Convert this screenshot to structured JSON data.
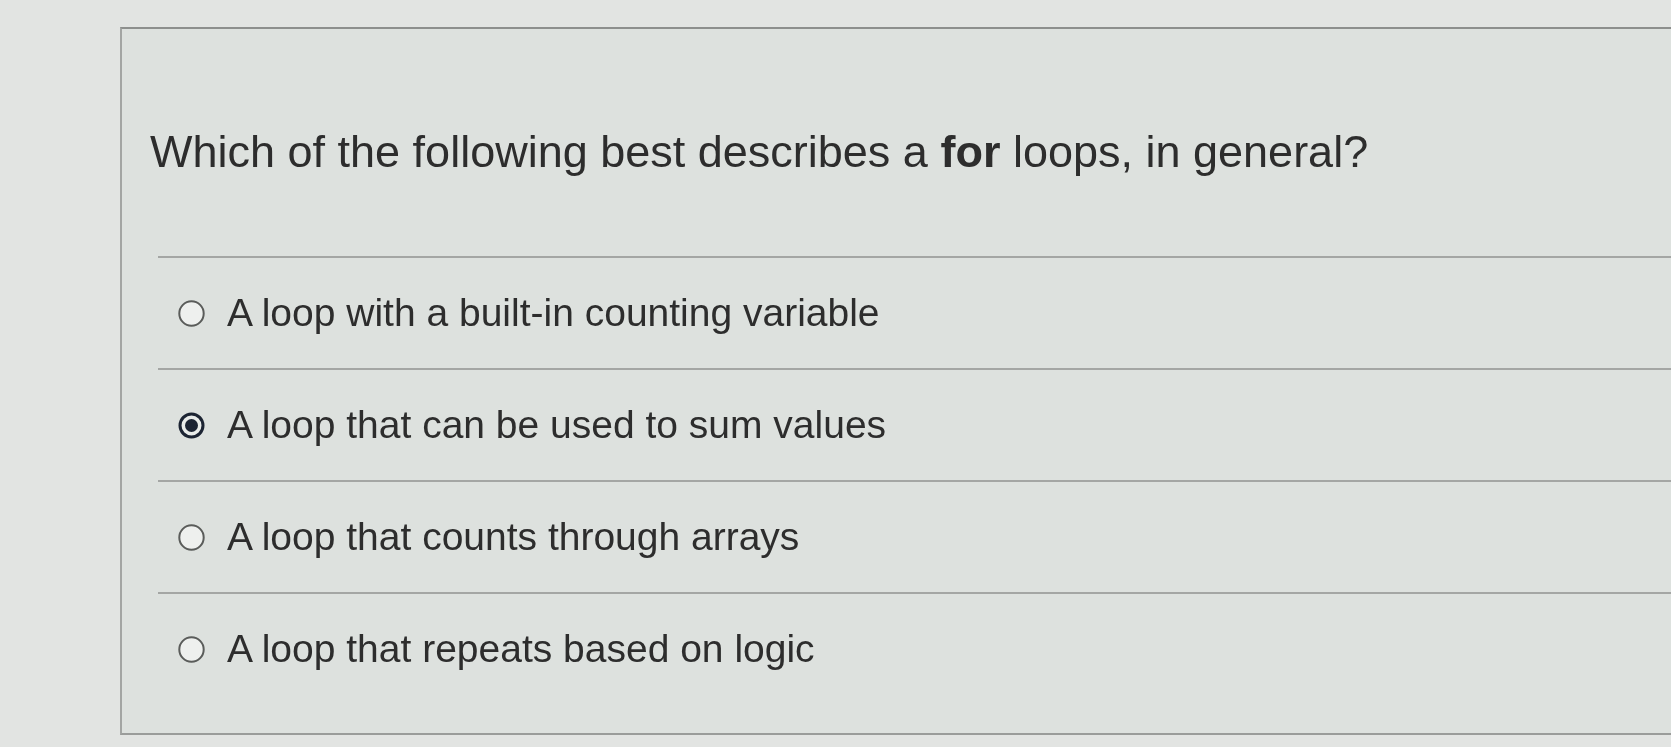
{
  "question": {
    "text": "Which of the following best describes a **for** loops, in general?"
  },
  "options": [
    {
      "label": "A loop with a built-in counting variable",
      "selected": false
    },
    {
      "label": "A loop that can be used to sum values",
      "selected": true
    },
    {
      "label": "A loop that counts through arrays",
      "selected": false
    },
    {
      "label": "A loop that repeats based on logic",
      "selected": false
    }
  ]
}
